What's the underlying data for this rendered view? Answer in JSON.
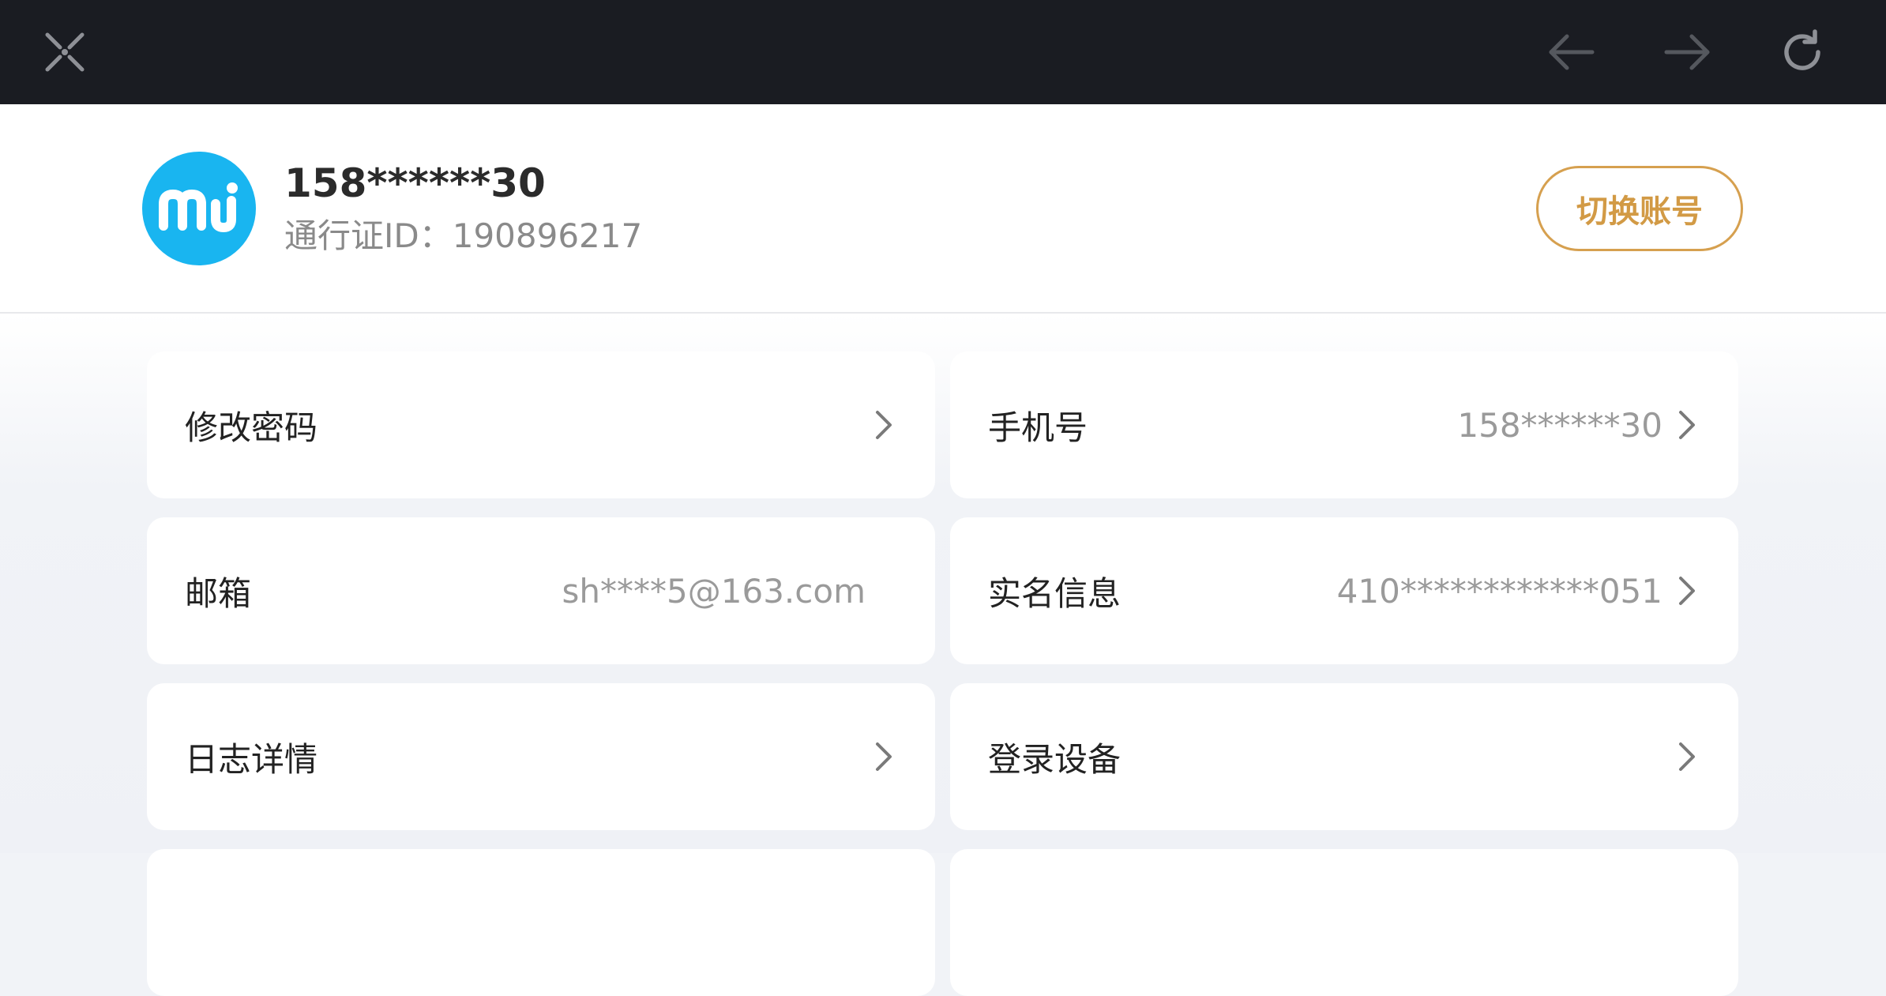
{
  "toolbar": {
    "close_icon": "close-icon",
    "back_icon": "arrow-left-icon",
    "forward_icon": "arrow-right-icon",
    "reload_icon": "reload-icon"
  },
  "profile": {
    "avatar_logo": "mi",
    "avatar_color": "#19b5f0",
    "phone": "158******30",
    "passport_id": "通行证ID：190896217",
    "switch_account": "切换账号",
    "accent_color": "#d29a45"
  },
  "items": [
    {
      "label": "修改密码",
      "value": "",
      "chevron": true
    },
    {
      "label": "手机号",
      "value": "158******30",
      "chevron": true
    },
    {
      "label": "邮箱",
      "value": "sh****5@163.com",
      "chevron": false
    },
    {
      "label": "实名信息",
      "value": "410************051",
      "chevron": true
    },
    {
      "label": "日志详情",
      "value": "",
      "chevron": true
    },
    {
      "label": "登录设备",
      "value": "",
      "chevron": true
    }
  ]
}
